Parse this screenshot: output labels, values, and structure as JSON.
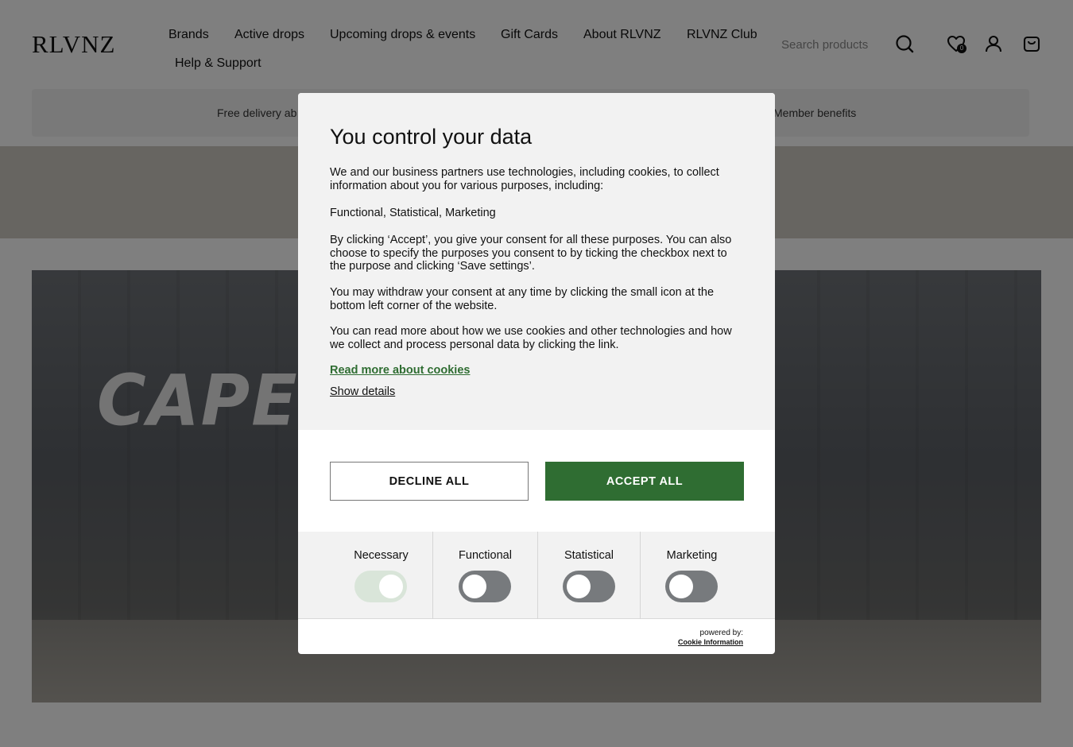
{
  "header": {
    "logo": "RLVNZ",
    "nav": [
      {
        "label": "Brands"
      },
      {
        "label": "Active drops"
      },
      {
        "label": "Upcoming drops & events"
      },
      {
        "label": "Gift Cards"
      },
      {
        "label": "About RLVNZ"
      },
      {
        "label": "RLVNZ Club"
      },
      {
        "label": "Help & Support"
      }
    ],
    "search": {
      "placeholder": "Search products",
      "value": ""
    },
    "icons": [
      "search-icon",
      "heart-icon",
      "user-icon",
      "bag-icon"
    ],
    "wishlist_count": "0"
  },
  "usp_bar": {
    "items": [
      "Free delivery ab",
      "Member benefits"
    ]
  },
  "hero": {
    "text": "CAPECA"
  },
  "cookie_modal": {
    "title": "You control your data",
    "intro": "We and our business partners use technologies, including cookies, to collect information about you for various purposes, including:",
    "purposes": "Functional, Statistical, Marketing",
    "consent_text": "By clicking ‘Accept’, you give your consent for all these purposes. You can also choose to specify the purposes you consent to by ticking the checkbox next to the purpose and clicking ‘Save settings’.",
    "withdraw_text": "You may withdraw your consent at any time by clicking the small icon at the bottom left corner of the website.",
    "read_more_text": "You can read more about how we use cookies and other technologies and how we collect and process personal data by clicking the link.",
    "read_more_link": "Read more about cookies",
    "show_details_link": "Show details",
    "decline_button": "DECLINE ALL",
    "accept_button": "ACCEPT ALL",
    "categories": [
      {
        "label": "Necessary",
        "enabled": true,
        "locked": true
      },
      {
        "label": "Functional",
        "enabled": false
      },
      {
        "label": "Statistical",
        "enabled": false
      },
      {
        "label": "Marketing",
        "enabled": false
      }
    ],
    "powered_by": "powered by:",
    "powered_brand": "Cookie Information"
  },
  "colors": {
    "accent_green": "#2f6d32",
    "toggle_off": "#777a7d",
    "toggle_on_locked": "#d9e5d9",
    "overlay": "rgba(0,0,0,0.5)"
  }
}
